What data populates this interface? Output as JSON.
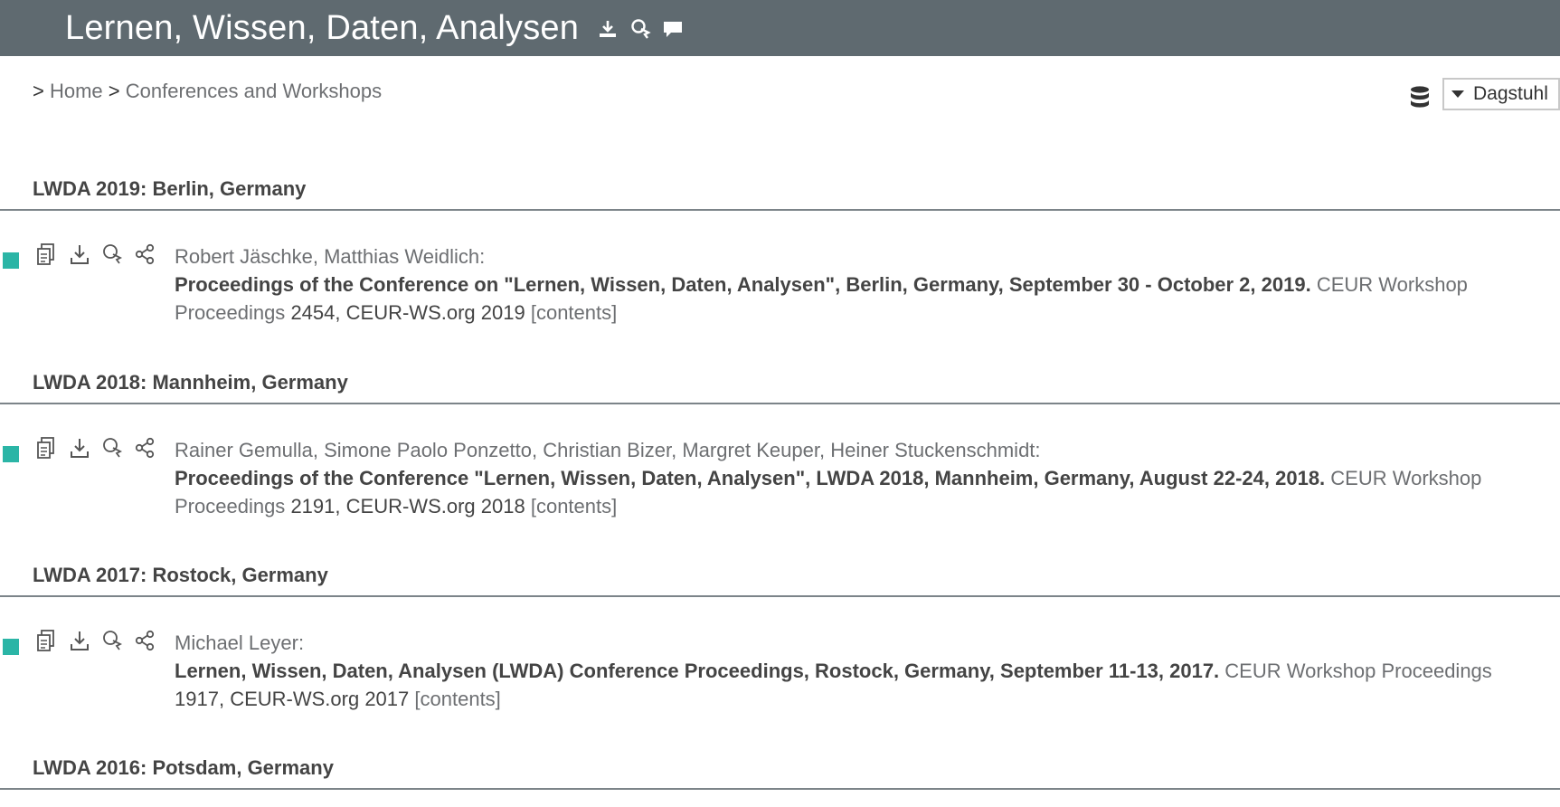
{
  "header": {
    "title": "Lernen, Wissen, Daten, Analysen",
    "icons": [
      "download-icon",
      "cite-icon",
      "comment-icon"
    ]
  },
  "breadcrumb": {
    "prefix": ">",
    "home": "Home",
    "separator": ">",
    "current": "Conferences and Workshops"
  },
  "mirror": {
    "icon": "database-icon",
    "selected": "Dagstuhl"
  },
  "colors": {
    "topbar": "#5f6a70",
    "marker": "#2bb5a6",
    "rule": "#7c8489"
  },
  "sections": [
    {
      "heading": "LWDA 2019: Berlin, Germany",
      "entries": [
        {
          "authors": [
            "Robert Jäschke",
            "Matthias Weidlich"
          ],
          "title": "Proceedings of the Conference on \"Lernen, Wissen, Daten, Analysen\", Berlin, Germany, September 30 - October 2, 2019.",
          "series": "CEUR Workshop Proceedings",
          "volume": "2454",
          "publisher": "CEUR-WS.org 2019",
          "contents_link": "[contents]"
        }
      ]
    },
    {
      "heading": "LWDA 2018: Mannheim, Germany",
      "entries": [
        {
          "authors": [
            "Rainer Gemulla",
            "Simone Paolo Ponzetto",
            "Christian Bizer",
            "Margret Keuper",
            "Heiner Stuckenschmidt"
          ],
          "title": "Proceedings of the Conference \"Lernen, Wissen, Daten, Analysen\", LWDA 2018, Mannheim, Germany, August 22-24, 2018.",
          "series": "CEUR Workshop Proceedings",
          "volume": "2191",
          "publisher": "CEUR-WS.org 2018",
          "contents_link": "[contents]"
        }
      ]
    },
    {
      "heading": "LWDA 2017: Rostock, Germany",
      "entries": [
        {
          "authors": [
            "Michael Leyer"
          ],
          "title": "Lernen, Wissen, Daten, Analysen (LWDA) Conference Proceedings, Rostock, Germany, September 11-13, 2017.",
          "series": "CEUR Workshop Proceedings",
          "volume": "1917",
          "publisher": "CEUR-WS.org 2017",
          "contents_link": "[contents]"
        }
      ]
    },
    {
      "heading": "LWDA 2016: Potsdam, Germany",
      "entries": []
    }
  ]
}
